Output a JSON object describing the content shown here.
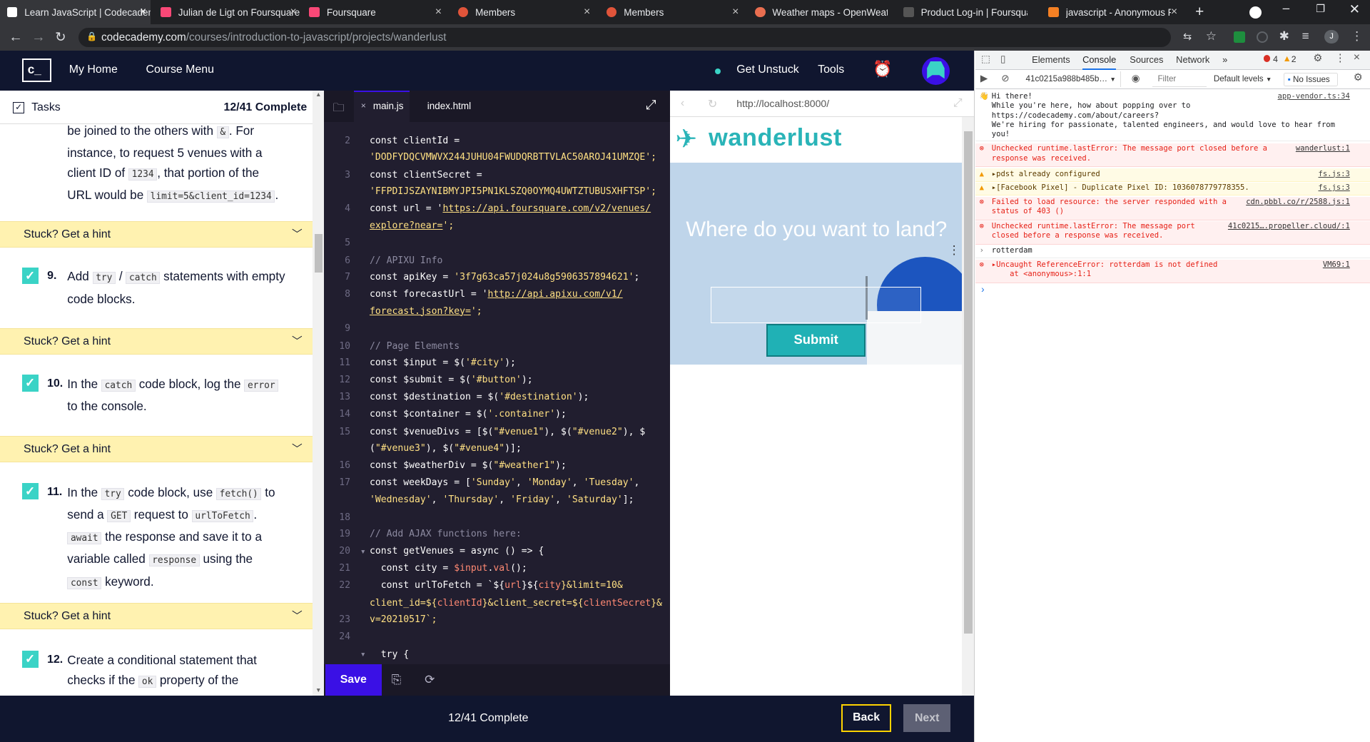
{
  "tabs": [
    {
      "title": "Learn JavaScript | Codecademy",
      "color": "#ffffff"
    },
    {
      "title": "Julian de Ligt on Foursquare",
      "color": "#f94877"
    },
    {
      "title": "Foursquare",
      "color": "#f94877"
    },
    {
      "title": "Members",
      "color": "#e0543a"
    },
    {
      "title": "Members",
      "color": "#e0543a"
    },
    {
      "title": "Weather maps - OpenWeather",
      "color": "#e96e50"
    },
    {
      "title": "Product Log-in | Foursquare",
      "color": "#555555"
    },
    {
      "title": "javascript - Anonymous Fu",
      "color": "#f48024"
    }
  ],
  "address": {
    "host": "codecademy.com",
    "path": "/courses/introduction-to-javascript/projects/wanderlust"
  },
  "header": {
    "logo": "c_",
    "my_home": "My Home",
    "course_menu": "Course Menu",
    "get_unstuck": "Get Unstuck",
    "tools": "Tools"
  },
  "tasks": {
    "title": "Tasks",
    "progress": "12/41 Complete",
    "top_text": {
      "l1a": "be joined to the others with",
      "l1c": "&",
      "l1b": ". For",
      "l2": "instance, to request 5 venues with a",
      "l3a": "client ID of",
      "l3c": "1234",
      "l3b": ", that portion of the",
      "l4a": "URL would be",
      "l4c": "limit=5&client_id=1234",
      "l4b": "."
    },
    "hint": "Stuck? Get a hint",
    "t9": {
      "num": "9.",
      "a": "Add",
      "c1": "try",
      "s": "/",
      "c2": "catch",
      "b": "statements with empty",
      "l2": "code blocks."
    },
    "t10": {
      "num": "10.",
      "a": "In the",
      "c1": "catch",
      "b": "code block, log the",
      "c2": "error",
      "l2": "to the console."
    },
    "t11": {
      "num": "11.",
      "a": "In the",
      "c1": "try",
      "b": "code block, use",
      "c2": "fetch()",
      "d": "to",
      "l2a": "send a",
      "l2c": "GET",
      "l2b": "request to",
      "l2c2": "urlToFetch",
      "l2d": ".",
      "l3c": "await",
      "l3": "the response and save it to a",
      "l4a": "variable called",
      "l4c": "response",
      "l4b": "using the",
      "l5c": "const",
      "l5": "keyword."
    },
    "t12": {
      "num": "12.",
      "l1": "Create a conditional statement that",
      "l2a": "checks if the",
      "l2c": "ok",
      "l2b": "property of the"
    }
  },
  "editor": {
    "tab1": "main.js",
    "tab2": "index.html",
    "line_numbers": [
      "2",
      "",
      "3",
      "",
      "4",
      "",
      "5",
      "6",
      "7",
      "8",
      "",
      "9",
      "10",
      "11",
      "12",
      "13",
      "14",
      "15",
      "",
      "16",
      "17",
      "",
      "18",
      "19",
      "20",
      "21",
      "22",
      "",
      "23",
      "24"
    ],
    "code": {
      "l2a": "const clientId =",
      "l2b": "'DODFYDQCVMWVX244JUHU04FWUDQRBTTVLAC50AROJ41UMZQE';",
      "l3a": "const clientSecret =",
      "l3b": "'FFPDIJSZAYNIBMYJPI5PN1KLSZQ0OYMQ4UWTZTUBUSXHFTSP';",
      "l4a": "const url = '",
      "l4url": "https://api.foursquare.com/v2/venues/",
      "l4b": "explore?near=",
      "l4c": "';",
      "l6": "// APIXU Info",
      "l7a": "const apiKey = ",
      "l7b": "'3f7g63ca57j024u8g5906357894621'",
      "l7c": ";",
      "l8a": "const forecastUrl = '",
      "l8url": "http://api.apixu.com/v1/",
      "l8b": "forecast.json?key=",
      "l8c": "';",
      "l10": "// Page Elements",
      "l11a": "const $input = $(",
      "l11b": "'#city'",
      "l11c": ");",
      "l12a": "const $submit = $(",
      "l12b": "'#button'",
      "l12c": ");",
      "l13a": "const $destination = $(",
      "l13b": "'#destination'",
      "l13c": ");",
      "l14a": "const $container = $(",
      "l14b": "'.container'",
      "l14c": ");",
      "l15a": "const $venueDivs = [$(",
      "l15b": "\"#venue1\"",
      "l15c": "), $(",
      "l15d": "\"#venue2\"",
      "l15e": "), $",
      "l15f": "(",
      "l15g": "\"#venue3\"",
      "l15h": "), $(",
      "l15i": "\"#venue4\"",
      "l15j": ")];",
      "l16a": "const $weatherDiv = $(",
      "l16b": "\"#weather1\"",
      "l16c": ");",
      "l17a": "const weekDays = [",
      "l17b": "'Sunday'",
      ",": ", ",
      "l17c": "'Monday'",
      "l17d": "'Tuesday'",
      "l17e": "'Wednesday'",
      "l17f": "'Thursday'",
      "l17g": "'Friday'",
      "l17h": "'Saturday'",
      "l17i": "];",
      "l19": "// Add AJAX functions here:",
      "l20": "const getVenues = async () => {",
      "l21a": "  const city = ",
      "l21b": "$input",
      "l21c": ".",
      "l21d": "val",
      "l21e": "();",
      "l22a": "  const urlToFetch = `${",
      "l22b": "url",
      "l22c": "}${",
      "l22d": "city",
      "l22e": "}&limit=10&",
      "l22f": "client_id=${",
      "l22g": "clientId",
      "l22h": "}&client_secret=${",
      "l22i": "clientSecret",
      "l22j": "}&",
      "l22k": "v=20210517`;",
      "l24": "  try {"
    },
    "save": "Save"
  },
  "preview": {
    "url": "http://localhost:8000/",
    "brand": "wanderlust",
    "heading": "Where do you want to land?",
    "submit": "Submit"
  },
  "footer": {
    "progress": "12/41 Complete",
    "back": "Back",
    "next": "Next"
  },
  "devtools": {
    "tabs": [
      "Elements",
      "Console",
      "Sources",
      "Network"
    ],
    "errors": "4",
    "warnings": "2",
    "context": "41c0215a988b485b…",
    "filter_placeholder": "Filter",
    "levels": "Default levels",
    "issues": "No Issues",
    "messages": [
      {
        "type": "log",
        "text": "Hi there!\nWhile you're here, how about popping over to https://codecademy.com/about/careers?\nWe're hiring for passionate, talented engineers, and would love to hear from you!",
        "src": "app-vendor.ts:34"
      },
      {
        "type": "error",
        "text": "Unchecked runtime.lastError: The message port closed before a\nresponse was received.",
        "src": "wanderlust:1"
      },
      {
        "type": "warn",
        "text": "▸pdst already configured",
        "src": "fs.js:3"
      },
      {
        "type": "warn",
        "text": "▸[Facebook Pixel] - Duplicate Pixel ID: 1036078779778355.",
        "src": "fs.js:3"
      },
      {
        "type": "error",
        "text": "Failed to load resource: the server responded with a\nstatus of 403 ()",
        "src": "cdn.pbbl.co/r/2588.js:1"
      },
      {
        "type": "error",
        "text": "Unchecked runtime.lastError: The message port\nclosed before a response was received.",
        "src": "41c0215….propeller.cloud/:1"
      },
      {
        "type": "log",
        "text": "rotterdam",
        "src": ""
      },
      {
        "type": "error",
        "text": "▸Uncaught ReferenceError: rotterdam is not defined\n    at <anonymous>:1:1",
        "src": "VM69:1"
      }
    ]
  }
}
